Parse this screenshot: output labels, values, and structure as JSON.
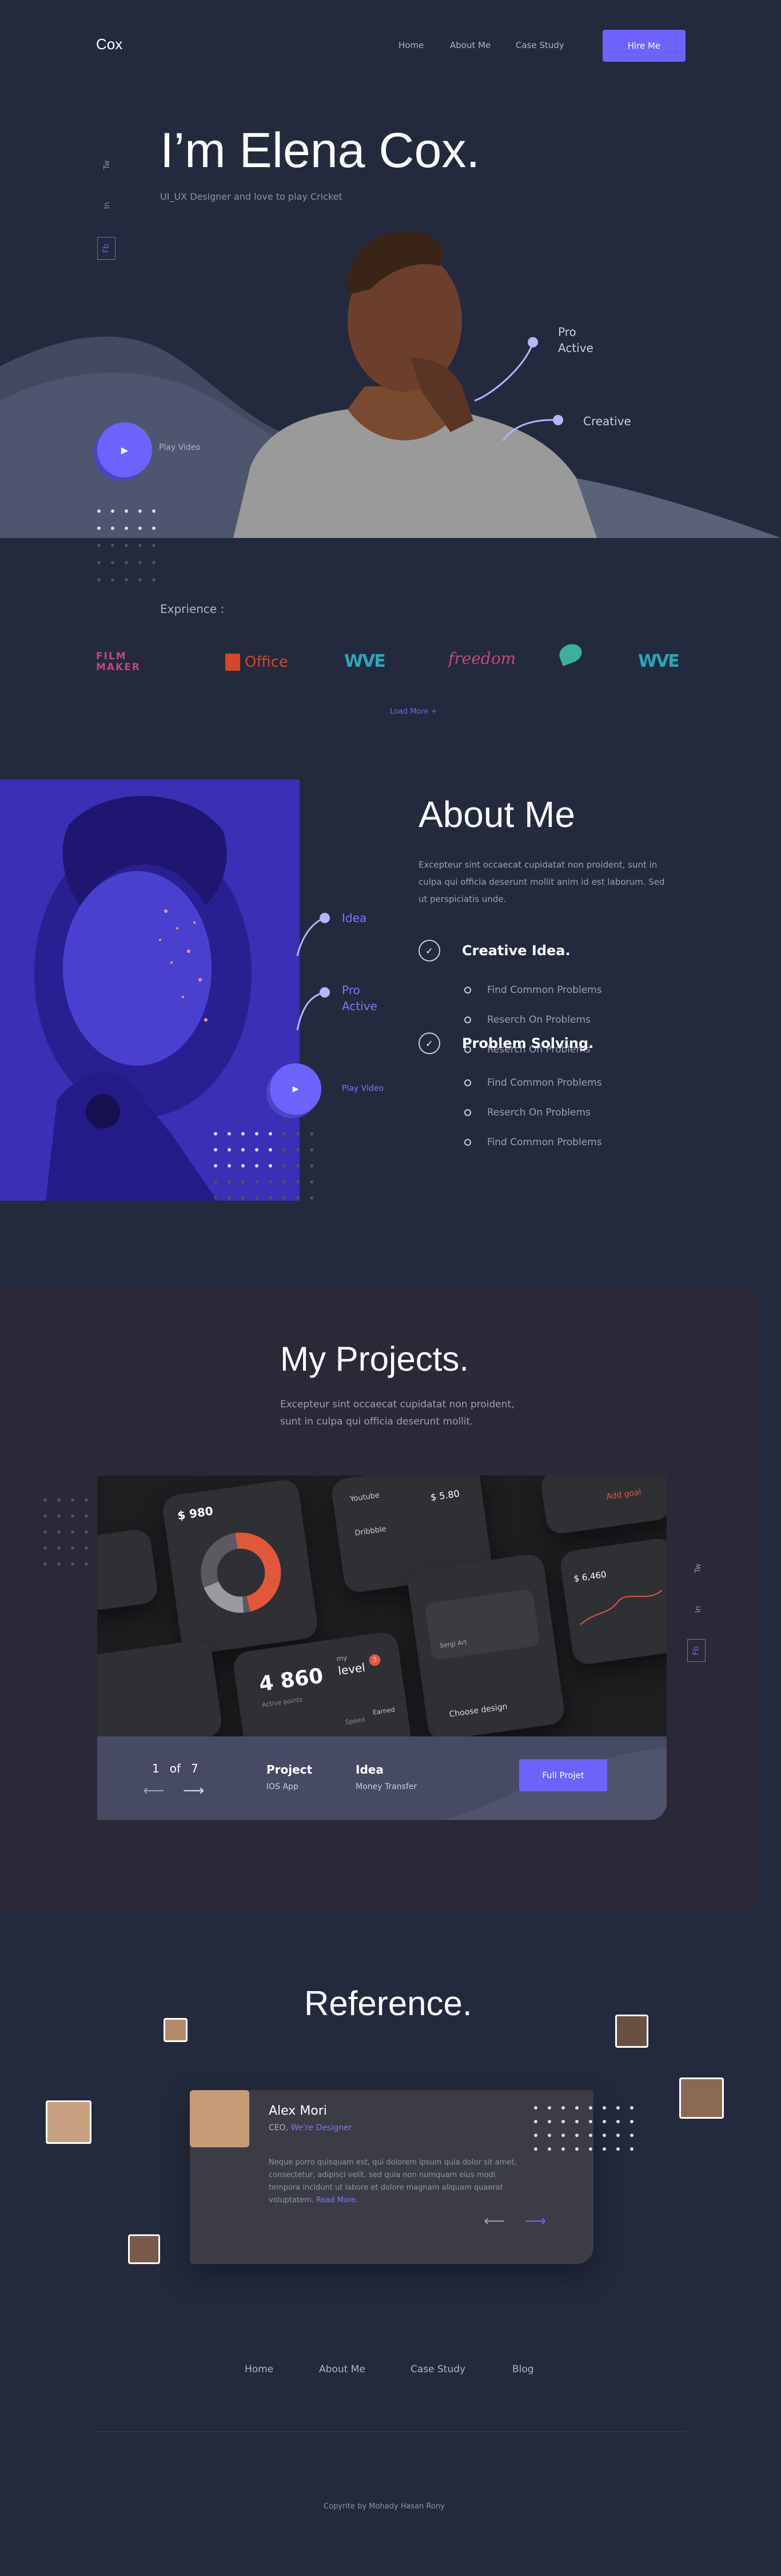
{
  "header": {
    "logo": "Cox",
    "nav": [
      "Home",
      "About Me",
      "Case Study"
    ],
    "hire_label": "Hire Me"
  },
  "hero": {
    "title": "I’m Elena Cox.",
    "subtitle": "UI_UX Designer and love to play Cricket",
    "social": [
      "Tw",
      "In",
      "Fb"
    ],
    "play_label": "Play Video",
    "callouts": {
      "pro_1": "Pro",
      "pro_2": "Active",
      "creative": "Creative"
    }
  },
  "experience": {
    "label": "Exprience :",
    "logos": {
      "film_1": "FILM",
      "film_2": "MAKER",
      "office": "Office",
      "wave": "WVE",
      "freedom": "freedom",
      "wave2": "WVE"
    },
    "load_more": "Load More +"
  },
  "about": {
    "title": "About Me",
    "text": "Excepteur sint occaecat cupidatat non proident, sunt in culpa qui officia deserunt mollit anim id est laborum. Sed ut perspiciatis unde.",
    "callouts": {
      "idea": "Idea",
      "pro_1": "Pro",
      "pro_2": "Active",
      "play": "Play Video"
    },
    "groups": [
      {
        "title": "Creative Idea.",
        "items": [
          "Find Common Problems",
          "Reserch On Problems",
          "Reserch On Problems"
        ]
      },
      {
        "title": "Problem Solving.",
        "items": [
          "Find Common Problems",
          "Reserch On Problems",
          "Find Common Problems"
        ]
      }
    ]
  },
  "projects": {
    "title": "My Projects.",
    "text_1": "Excepteur sint occaecat cupidatat non proident,",
    "text_2": "sunt in culpa qui officia deserunt mollit.",
    "social": [
      "Tw",
      "In",
      "Fb"
    ],
    "pager": {
      "current": "1",
      "of": "of",
      "total": "7"
    },
    "project_label": "Project",
    "project_value": "IOS App",
    "idea_label": "Idea",
    "idea_value": "Money Transfer",
    "button": "Full Projet",
    "mockup": {
      "amount_1": "$ 980",
      "amount_2": "$ 5.80",
      "amount_3": "$ 6,460",
      "big_number": "4 860",
      "big_sub": "Active points",
      "level": "level",
      "level_num": "3",
      "my": "my",
      "youtube": "Youtube",
      "dribbble": "Dribbble",
      "add_goal": "Add goal",
      "choose": "Choose design",
      "speed": "Speed",
      "earned": "Earned",
      "card_name": "Sergi Art"
    }
  },
  "reference": {
    "title": "Reference.",
    "name": "Alex Mori",
    "role_prefix": "CEO,",
    "role_company": "We're Designer",
    "quote": "Neque porro quisquam est, qui dolorem ipsum quia dolor sit amet, consectetur, adipisci velit, sed quia non numquam eius modi tempora incidunt ut labore et dolore magnam aliquam quaerat voluptatem.",
    "read_more": "Read More.",
    "arrow_prev": "⟵",
    "arrow_next": "⟶"
  },
  "footer": {
    "nav": [
      "Home",
      "About Me",
      "Case Study",
      "Blog"
    ],
    "copyright": "Copyrite by Mohady Hasan Rony"
  },
  "colors": {
    "accent": "#6c63ff",
    "bg": "#232a3d",
    "dark_section": "#2b2938"
  }
}
